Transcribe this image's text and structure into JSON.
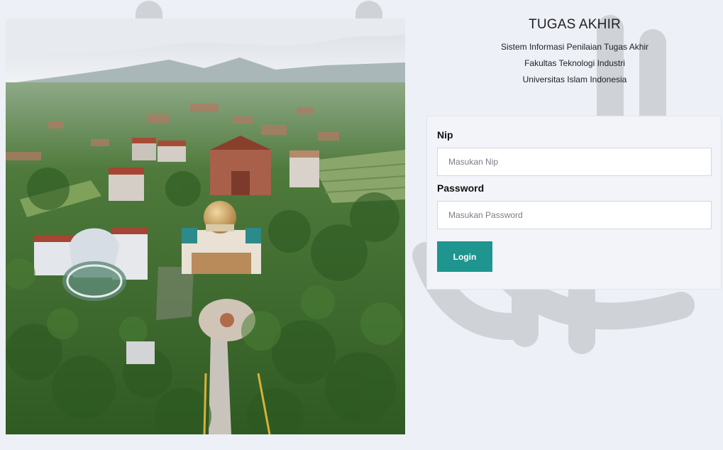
{
  "header": {
    "title": "TUGAS AKHIR",
    "subtitle_line1": "Sistem Informasi Penilaian Tugas Akhir",
    "subtitle_line2": "Fakultas Teknologi Industri",
    "subtitle_line3": "Universitas Islam Indonesia"
  },
  "login": {
    "nip_label": "Nip",
    "nip_placeholder": "Masukan Nip",
    "nip_value": "",
    "password_label": "Password",
    "password_placeholder": "Masukan Password",
    "password_value": "",
    "login_button": "Login"
  },
  "colors": {
    "accent": "#1e958f",
    "background": "#edf0f6"
  },
  "icons": {
    "watermark": "uii-logo-watermark",
    "photo": "campus-aerial-photo"
  }
}
